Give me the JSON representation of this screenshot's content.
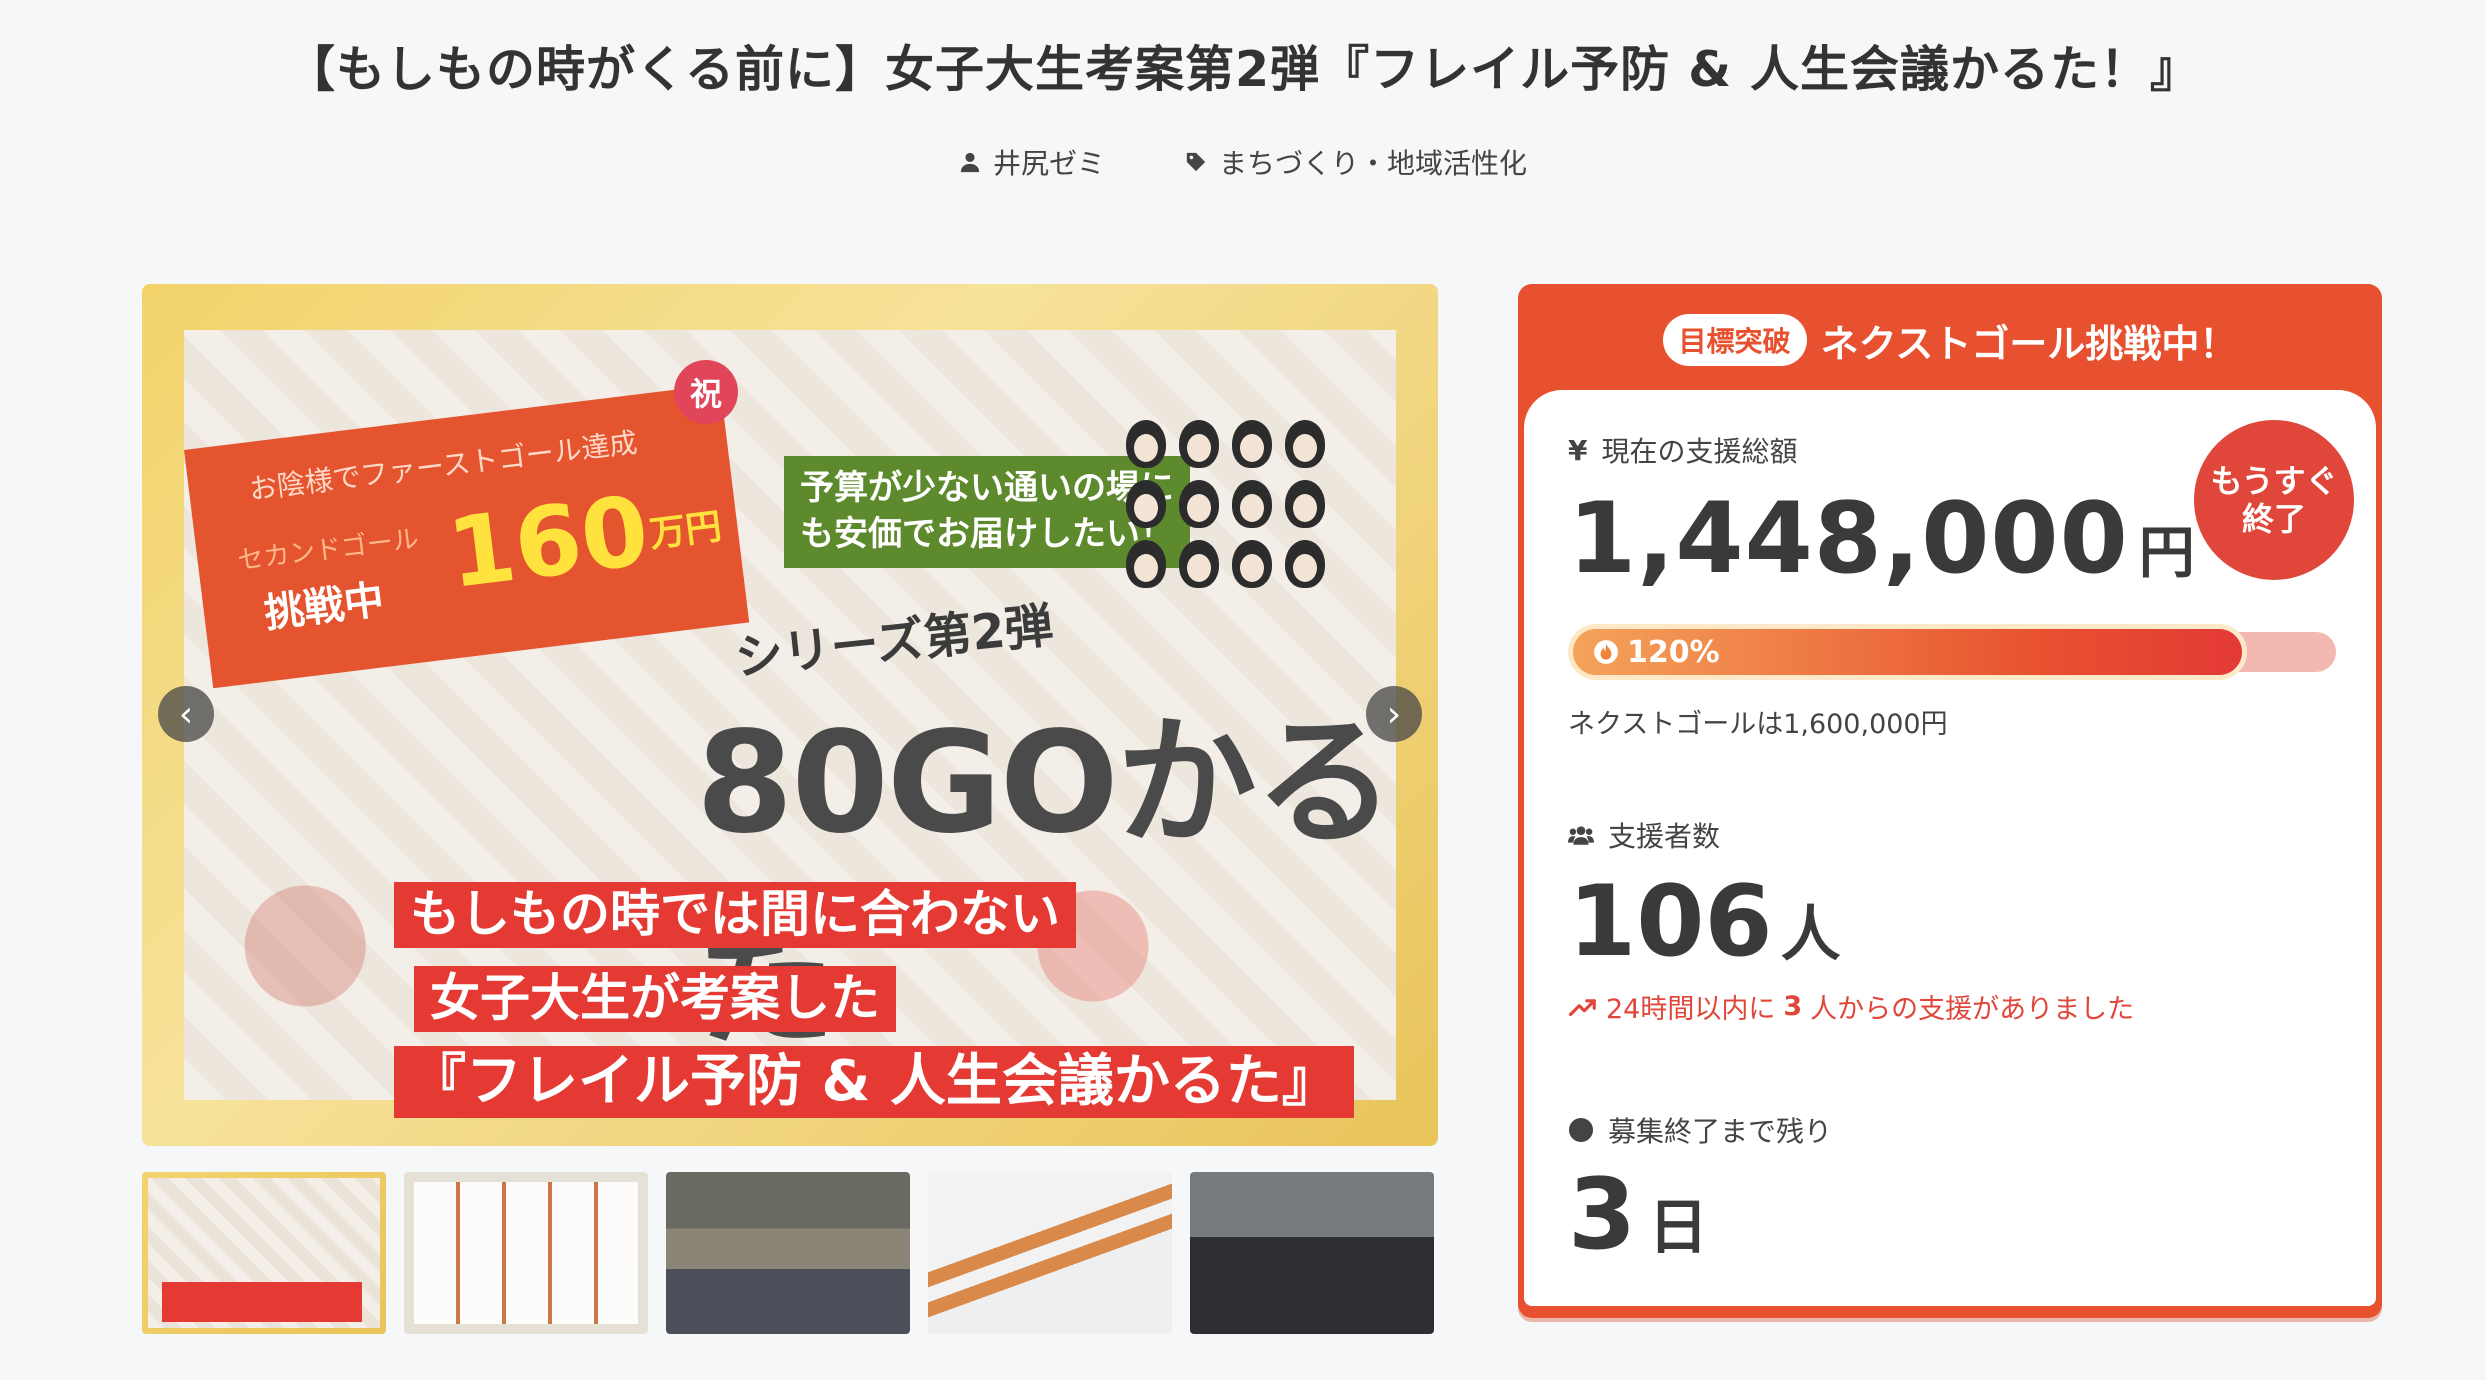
{
  "page": {
    "title": "【もしもの時がくる前に】女子大生考案第2弾『フレイル予防 & 人生会議かるた！』",
    "owner": "井尻ゼミ",
    "category": "まちづくり・地域活性化"
  },
  "hero": {
    "shuku": "祝",
    "ribbon_line1": "お陰様でファーストゴール達成",
    "ribbon_line2": "セカンドゴール",
    "ribbon_line3": "挑戦中",
    "ribbon_amount": "160",
    "ribbon_unit": "万円",
    "green_box": "予算が少ない通いの場に\nも安価でお届けしたい！",
    "series": "シリーズ第2弾",
    "karuta": "80GOかるた",
    "red_line1": "もしもの時では間に合わない",
    "red_line2": "女子大生が考案した",
    "red_line3": "『フレイル予防 & 人生会議かるた』",
    "prev": "‹",
    "next": "›"
  },
  "panel": {
    "tag": "目標突破",
    "head": "ネクストゴール挑戦中！",
    "soon": "もうすぐ\n終了",
    "total_label": "現在の支援総額",
    "total_amount": "1,448,000",
    "total_unit": "円",
    "progress_percent": 120,
    "progress_label": "120%",
    "next_goal": "ネクストゴールは1,600,000円",
    "supporters_label": "支援者数",
    "supporters": "106",
    "supporters_unit": "人",
    "recent_prefix": "24時間以内に",
    "recent_count": "3",
    "recent_suffix": "人からの支援がありました",
    "remain_label": "募集終了まで残り",
    "remain": "3",
    "remain_unit": "日"
  },
  "colors": {
    "accent": "#e8512f",
    "bar_track": "#f4b8b2",
    "text": "#3a3a3a"
  }
}
